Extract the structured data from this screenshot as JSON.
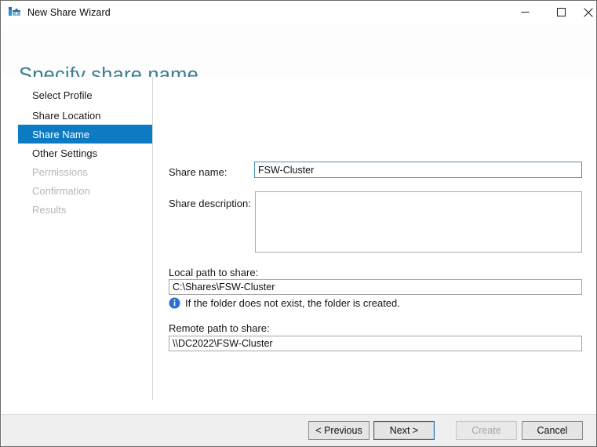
{
  "window": {
    "title": "New Share Wizard",
    "icon": "share-wizard-icon",
    "controls": {
      "minimize": "minimize-icon",
      "maximize": "maximize-icon",
      "close": "close-icon"
    }
  },
  "header": {
    "title": "Specify share name",
    "title_color": "#3c7e91"
  },
  "sidebar": {
    "active_index": 2,
    "active_color": "#0d7bc4",
    "items": [
      {
        "label": "Select Profile",
        "state": "completed"
      },
      {
        "label": "Share Location",
        "state": "completed"
      },
      {
        "label": "Share Name",
        "state": "active"
      },
      {
        "label": "Other Settings",
        "state": "enabled"
      },
      {
        "label": "Permissions",
        "state": "disabled"
      },
      {
        "label": "Confirmation",
        "state": "disabled"
      },
      {
        "label": "Results",
        "state": "disabled"
      }
    ]
  },
  "form": {
    "share_name": {
      "label": "Share name:",
      "value": "FSW-Cluster",
      "placeholder": "",
      "focused": true
    },
    "share_description": {
      "label": "Share description:",
      "value": "",
      "placeholder": ""
    },
    "local_path": {
      "label": "Local path to share:",
      "value": "C:\\Shares\\FSW-Cluster",
      "placeholder": ""
    },
    "info": {
      "icon": "info-icon",
      "text": "If the folder does not exist, the folder is created."
    },
    "remote_path": {
      "label": "Remote path to share:",
      "value": "\\\\DC2022\\FSW-Cluster",
      "placeholder": ""
    }
  },
  "footer": {
    "buttons": [
      {
        "label": "< Previous",
        "state": "enabled"
      },
      {
        "label": "Next >",
        "state": "focused"
      },
      {
        "label": "Create",
        "state": "disabled"
      },
      {
        "label": "Cancel",
        "state": "enabled"
      }
    ]
  }
}
